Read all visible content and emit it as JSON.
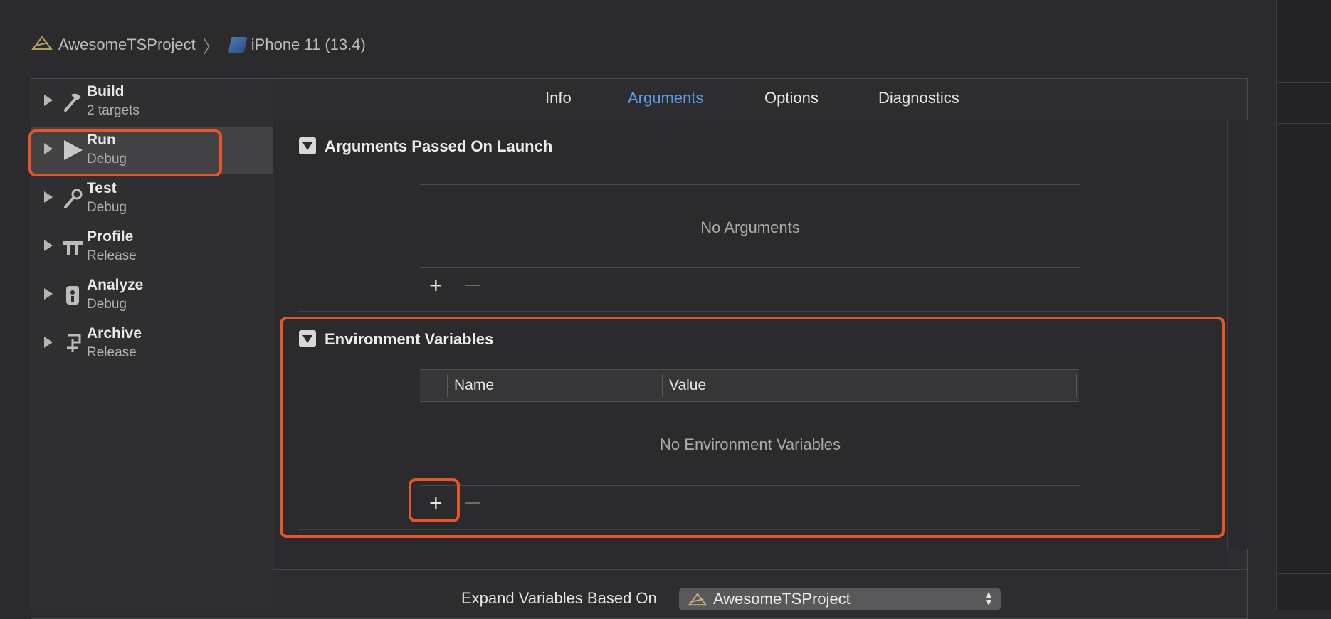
{
  "breadcrumb": {
    "project": "AwesomeTSProject",
    "device": "iPhone 11 (13.4)"
  },
  "sidebar": {
    "items": [
      {
        "title": "Build",
        "subtitle": "2 targets",
        "icon": "hammer-icon"
      },
      {
        "title": "Run",
        "subtitle": "Debug",
        "icon": "play-icon",
        "selected": true
      },
      {
        "title": "Test",
        "subtitle": "Debug",
        "icon": "wrench-icon"
      },
      {
        "title": "Profile",
        "subtitle": "Release",
        "icon": "caliper-icon"
      },
      {
        "title": "Analyze",
        "subtitle": "Debug",
        "icon": "analyze-icon"
      },
      {
        "title": "Archive",
        "subtitle": "Release",
        "icon": "archive-icon"
      }
    ]
  },
  "tabs": {
    "info": "Info",
    "arguments": "Arguments",
    "options": "Options",
    "diagnostics": "Diagnostics",
    "active": "Arguments"
  },
  "arguments_section": {
    "title": "Arguments Passed On Launch",
    "empty": "No Arguments"
  },
  "env_section": {
    "title": "Environment Variables",
    "col_name": "Name",
    "col_value": "Value",
    "empty": "No Environment Variables"
  },
  "bottom": {
    "expand_label": "Expand Variables Based On",
    "expand_value": "AwesomeTSProject"
  },
  "colors": {
    "accent": "#5a9cf0",
    "highlight": "#e8542b"
  }
}
